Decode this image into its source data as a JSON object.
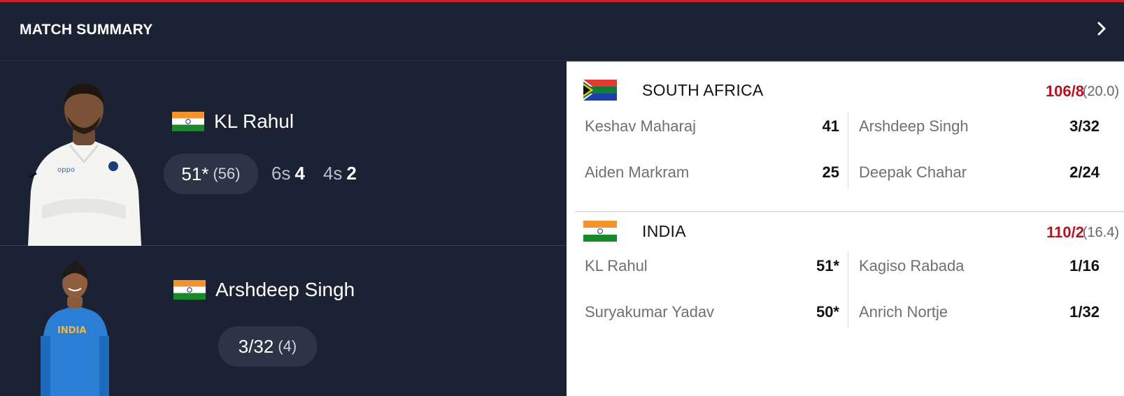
{
  "header": {
    "title": "MATCH SUMMARY",
    "arrow_icon": "chevron-right-icon"
  },
  "players": [
    {
      "name": "KL Rahul",
      "flag": "india-flag",
      "score": "51*",
      "balls": "(56)",
      "sixes_label": "6s",
      "sixes": "4",
      "fours_label": "4s",
      "fours": "2"
    },
    {
      "name": "Arshdeep Singh",
      "flag": "india-flag",
      "figures": "3/32",
      "overs": "(4)"
    }
  ],
  "innings": [
    {
      "team": "SOUTH AFRICA",
      "flag": "south-africa-flag",
      "score": "106/8",
      "overs": "(20.0)",
      "batters": [
        {
          "name": "Keshav Maharaj",
          "value": "41"
        },
        {
          "name": "Aiden Markram",
          "value": "25"
        }
      ],
      "bowlers": [
        {
          "name": "Arshdeep Singh",
          "value": "3/32"
        },
        {
          "name": "Deepak Chahar",
          "value": "2/24"
        }
      ]
    },
    {
      "team": "INDIA",
      "flag": "india-flag",
      "score": "110/2",
      "overs": "(16.4)",
      "batters": [
        {
          "name": "KL Rahul",
          "value": "51*"
        },
        {
          "name": "Suryakumar Yadav",
          "value": "50*"
        }
      ],
      "bowlers": [
        {
          "name": "Kagiso Rabada",
          "value": "1/16"
        },
        {
          "name": "Anrich Nortje",
          "value": "1/32"
        }
      ]
    }
  ],
  "colors": {
    "accent_red": "#d11f2e",
    "score_red": "#b3141f",
    "dark_bg": "#1a2233",
    "pill_bg": "#2c3546"
  }
}
